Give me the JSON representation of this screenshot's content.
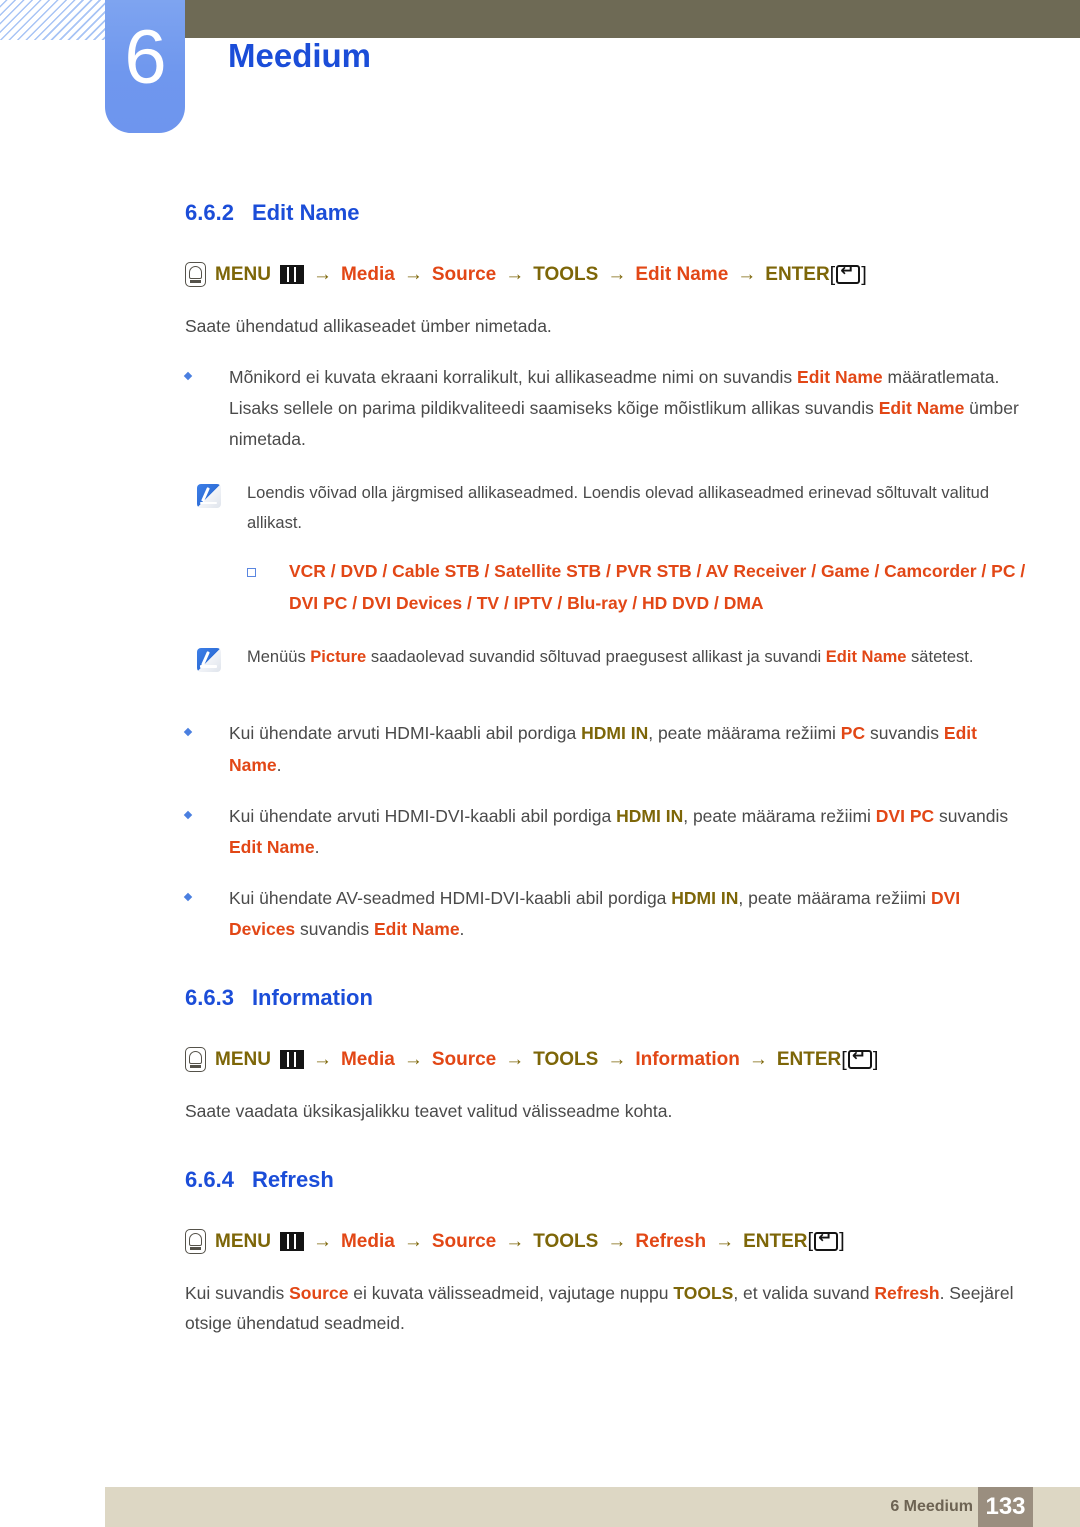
{
  "header": {
    "chapter_number": "6",
    "chapter_title": "Meedium",
    "accent_blue": "#1b4dd8",
    "topbar_color": "#6e6a55"
  },
  "sections": [
    {
      "number": "6.6.2",
      "title": "Edit Name",
      "path": {
        "menu_label": "MENU",
        "items": [
          "Media",
          "Source",
          "TOOLS",
          "Edit Name"
        ],
        "enter_label": "ENTER"
      },
      "intro": "Saate ühendatud allikaseadet ümber nimetada.",
      "bullets": [
        {
          "parts": [
            {
              "t": "Mõnikord ei kuvata ekraani korralikult, kui allikaseadme nimi on suvandis ",
              "s": "n"
            },
            {
              "t": "Edit Name",
              "s": "o"
            },
            {
              "t": " määratlemata. Lisaks sellele on parima pildikvaliteedi saamiseks kõige mõistlikum allikas suvandis ",
              "s": "n"
            },
            {
              "t": "Edit Name",
              "s": "o"
            },
            {
              "t": " ümber nimetada.",
              "s": "n"
            }
          ]
        }
      ],
      "note1": "Loendis võivad olla järgmised allikaseadmed. Loendis olevad allikaseadmed erinevad sõltuvalt valitud allikast.",
      "device_list": "VCR / DVD / Cable STB / Satellite STB / PVR STB / AV Receiver / Game / Camcorder / PC / DVI PC / DVI Devices / TV / IPTV / Blu-ray / HD DVD / DMA",
      "note2_parts": [
        {
          "t": "Menüüs ",
          "s": "n"
        },
        {
          "t": "Picture",
          "s": "o"
        },
        {
          "t": " saadaolevad suvandid sõltuvad praegusest allikast ja suvandi ",
          "s": "n"
        },
        {
          "t": "Edit Name",
          "s": "o"
        },
        {
          "t": " sätetest.",
          "s": "n"
        }
      ],
      "bullets2": [
        {
          "parts": [
            {
              "t": "Kui ühendate arvuti HDMI-kaabli abil pordiga ",
              "s": "n"
            },
            {
              "t": "HDMI IN",
              "s": "ol"
            },
            {
              "t": ", peate määrama režiimi ",
              "s": "n"
            },
            {
              "t": "PC",
              "s": "o"
            },
            {
              "t": " suvandis ",
              "s": "n"
            },
            {
              "t": "Edit Name",
              "s": "o"
            },
            {
              "t": ".",
              "s": "n"
            }
          ]
        },
        {
          "parts": [
            {
              "t": "Kui ühendate arvuti HDMI-DVI-kaabli abil pordiga ",
              "s": "n"
            },
            {
              "t": "HDMI IN",
              "s": "ol"
            },
            {
              "t": ", peate määrama režiimi ",
              "s": "n"
            },
            {
              "t": "DVI PC",
              "s": "o"
            },
            {
              "t": " suvandis ",
              "s": "n"
            },
            {
              "t": "Edit Name",
              "s": "o"
            },
            {
              "t": ".",
              "s": "n"
            }
          ]
        },
        {
          "parts": [
            {
              "t": "Kui ühendate AV-seadmed HDMI-DVI-kaabli abil pordiga ",
              "s": "n"
            },
            {
              "t": "HDMI IN",
              "s": "ol"
            },
            {
              "t": ", peate määrama režiimi ",
              "s": "n"
            },
            {
              "t": "DVI Devices",
              "s": "o"
            },
            {
              "t": " suvandis ",
              "s": "n"
            },
            {
              "t": "Edit Name",
              "s": "o"
            },
            {
              "t": ".",
              "s": "n"
            }
          ]
        }
      ]
    },
    {
      "number": "6.6.3",
      "title": "Information",
      "path": {
        "menu_label": "MENU",
        "items": [
          "Media",
          "Source",
          "TOOLS",
          "Information"
        ],
        "enter_label": "ENTER"
      },
      "intro": "Saate vaadata üksikasjalikku teavet valitud välisseadme kohta."
    },
    {
      "number": "6.6.4",
      "title": "Refresh",
      "path": {
        "menu_label": "MENU",
        "items": [
          "Media",
          "Source",
          "TOOLS",
          "Refresh"
        ],
        "enter_label": "ENTER"
      },
      "intro_parts": [
        {
          "t": "Kui suvandis ",
          "s": "n"
        },
        {
          "t": "Source",
          "s": "o"
        },
        {
          "t": " ei kuvata välisseadmeid, vajutage nuppu ",
          "s": "n"
        },
        {
          "t": "TOOLS",
          "s": "ol"
        },
        {
          "t": ", et valida suvand ",
          "s": "n"
        },
        {
          "t": "Refresh",
          "s": "o"
        },
        {
          "t": ". Seejärel otsige ühendatud seadmeid.",
          "s": "n"
        }
      ]
    }
  ],
  "footer": {
    "label": "6 Meedium",
    "page": "133"
  },
  "icons": {
    "remote_button": "remote-button-icon",
    "menu_grid": "menu-grid-icon",
    "enter_key": "enter-key-icon",
    "note": "note-pencil-icon"
  },
  "colors": {
    "orange": "#e24716",
    "olive": "#7d6608",
    "heading_blue": "#1b4dd8",
    "body_gray": "#4a4a4a",
    "footer_bar": "#ddd7c4",
    "footer_page_box": "#9a8e7f"
  }
}
